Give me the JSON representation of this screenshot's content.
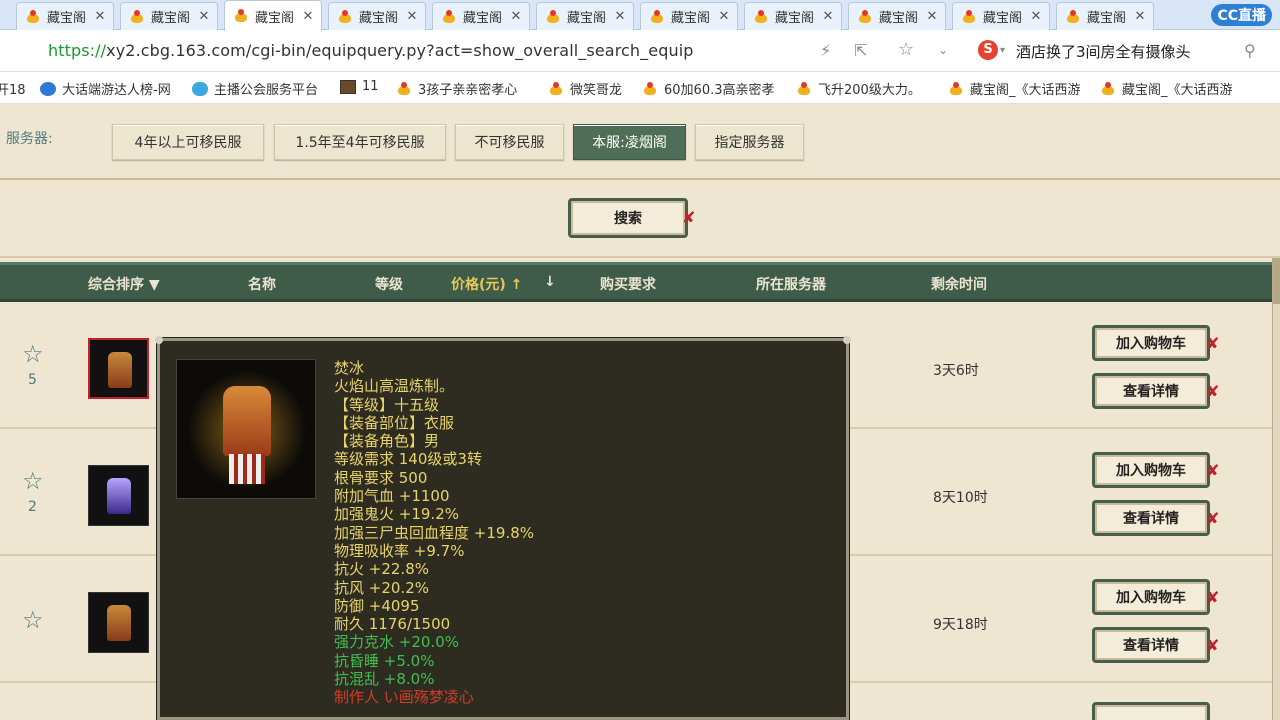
{
  "browser": {
    "tabs": [
      {
        "label": "藏宝阁"
      },
      {
        "label": "藏宝阁"
      },
      {
        "label": "藏宝阁"
      },
      {
        "label": "藏宝阁"
      },
      {
        "label": "藏宝阁"
      },
      {
        "label": "藏宝阁"
      },
      {
        "label": "藏宝阁"
      },
      {
        "label": "藏宝阁"
      },
      {
        "label": "藏宝阁"
      },
      {
        "label": "藏宝阁"
      },
      {
        "label": "藏宝阁"
      }
    ],
    "cc_logo": "CC直播",
    "url_scheme": "https://",
    "url_rest": "xy2.cbg.163.com/cgi-bin/equipquery.py?act=show_overall_search_equip",
    "search_brand": "S",
    "search_suggestion": "酒店换了3间房全有摄像头",
    "bookmarks": [
      {
        "label": "开18",
        "icon": "none"
      },
      {
        "label": "大话端游达人榜-网",
        "icon": "blue"
      },
      {
        "label": "主播公会服务平台",
        "icon": "cloud"
      },
      {
        "label": "11",
        "icon": "img"
      },
      {
        "label": "3孩子亲亲密孝心",
        "icon": "gold"
      },
      {
        "label": "微笑哥龙",
        "icon": "gold"
      },
      {
        "label": "60加60.3高亲密孝",
        "icon": "gold"
      },
      {
        "label": "飞升200级大力。",
        "icon": "gold"
      },
      {
        "label": "藏宝阁_《大话西游",
        "icon": "gold"
      },
      {
        "label": "藏宝阁_《大话西游",
        "icon": "gold"
      }
    ]
  },
  "servers": {
    "label": "服务器:",
    "buttons": [
      {
        "label": "4年以上可移民服"
      },
      {
        "label": "1.5年至4年可移民服"
      },
      {
        "label": "不可移民服"
      },
      {
        "label": "本服:凌烟阁"
      },
      {
        "label": "指定服务器"
      }
    ]
  },
  "search": {
    "button": "搜索"
  },
  "table": {
    "headers": {
      "sort": "综合排序 ▼",
      "name": "名称",
      "level": "等级",
      "price": "价格(元) ↑",
      "price_down": "↓",
      "requirement": "购买要求",
      "server": "所在服务器",
      "remaining": "剩余时间"
    },
    "rows": [
      {
        "rank": "5",
        "time": "3天6时",
        "add_cart": "加入购物车",
        "details": "查看详情"
      },
      {
        "rank": "2",
        "time": "8天10时",
        "add_cart": "加入购物车",
        "details": "查看详情"
      },
      {
        "rank": "",
        "time": "9天18时",
        "add_cart": "加入购物车",
        "details": "查看详情"
      }
    ]
  },
  "tooltip": {
    "lines": [
      {
        "text": "焚冰",
        "color": "yellow"
      },
      {
        "text": "火焰山高温炼制。",
        "color": "yellow"
      },
      {
        "text": "【等级】十五级",
        "color": "yellow"
      },
      {
        "text": "【装备部位】衣服",
        "color": "yellow"
      },
      {
        "text": "【装备角色】男",
        "color": "yellow"
      },
      {
        "text": "等级需求 140级或3转",
        "color": "yellow"
      },
      {
        "text": "根骨要求 500",
        "color": "yellow"
      },
      {
        "text": "附加气血 +1100",
        "color": "yellow"
      },
      {
        "text": "加强鬼火 +19.2%",
        "color": "yellow"
      },
      {
        "text": "加强三尸虫回血程度 +19.8%",
        "color": "yellow"
      },
      {
        "text": "物理吸收率 +9.7%",
        "color": "yellow"
      },
      {
        "text": "抗火 +22.8%",
        "color": "yellow"
      },
      {
        "text": "抗风 +20.2%",
        "color": "yellow"
      },
      {
        "text": "防御 +4095",
        "color": "yellow"
      },
      {
        "text": "耐久 1176/1500",
        "color": "yellow"
      },
      {
        "text": "强力克水 +20.0%",
        "color": "green"
      },
      {
        "text": "抗昏睡 +5.0%",
        "color": "green"
      },
      {
        "text": "抗混乱 +8.0%",
        "color": "green"
      },
      {
        "text": "制作人 い画殇梦凌心",
        "color": "red"
      }
    ]
  },
  "colors": {
    "header_bg": "#3f5b4a",
    "active_server": "#4f6e57",
    "tooltip_bg": "#2e2b21",
    "accent_red": "#c0202a"
  }
}
